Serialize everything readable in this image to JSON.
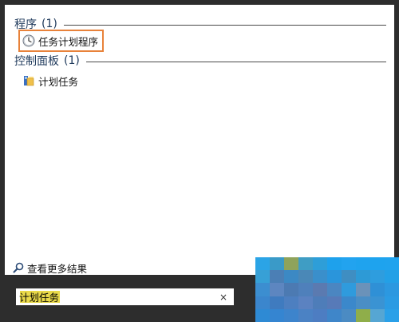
{
  "groups": {
    "programs": {
      "title": "程序",
      "count": "(1)",
      "items": [
        {
          "label": "任务计划程序",
          "icon": "clock-icon"
        }
      ]
    },
    "control_panel": {
      "title": "控制面板",
      "count": "(1)",
      "items": [
        {
          "label": "计划任务",
          "icon": "folder-tasks-icon"
        }
      ]
    }
  },
  "see_more": {
    "label": "查看更多结果",
    "icon": "search-icon"
  },
  "search": {
    "value": "计划任务",
    "clear_glyph": "×"
  },
  "colors": {
    "highlight_border": "#e8823a",
    "query_highlight": "#e9d94a",
    "panel_background": "#2d2d2d"
  },
  "mosaic": {
    "colors": [
      "#2ba4e6",
      "#3a9ac8",
      "#8fa35b",
      "#3f9dc4",
      "#2e9ed8",
      "#1ea1ec",
      "#22a3ef",
      "#1fa3ee",
      "#1ea3ee",
      "#1fa3ee",
      "#37a0d6",
      "#4b7fb5",
      "#3c89c4",
      "#4a88b7",
      "#3a8fcb",
      "#2a95db",
      "#3f8ec2",
      "#2d9ad6",
      "#2e9dde",
      "#23a0e6",
      "#3c8ed0",
      "#5d86c0",
      "#4c7ab2",
      "#4f80bb",
      "#5b7ab0",
      "#4b86c1",
      "#2f9bdd",
      "#6b92b9",
      "#2f90d6",
      "#2c98e0",
      "#3b86cd",
      "#3f7bbf",
      "#4d7fc0",
      "#5b82c1",
      "#4e7db9",
      "#577ab8",
      "#3b88cb",
      "#4a8ec5",
      "#3a93d3",
      "#2b9be3",
      "#2e8ad4",
      "#3585d1",
      "#3d84cc",
      "#4b82c4",
      "#4d7dc2",
      "#3f86c9",
      "#4b8bc3",
      "#8fae4a",
      "#56a6d3",
      "#2aa0e8"
    ]
  }
}
